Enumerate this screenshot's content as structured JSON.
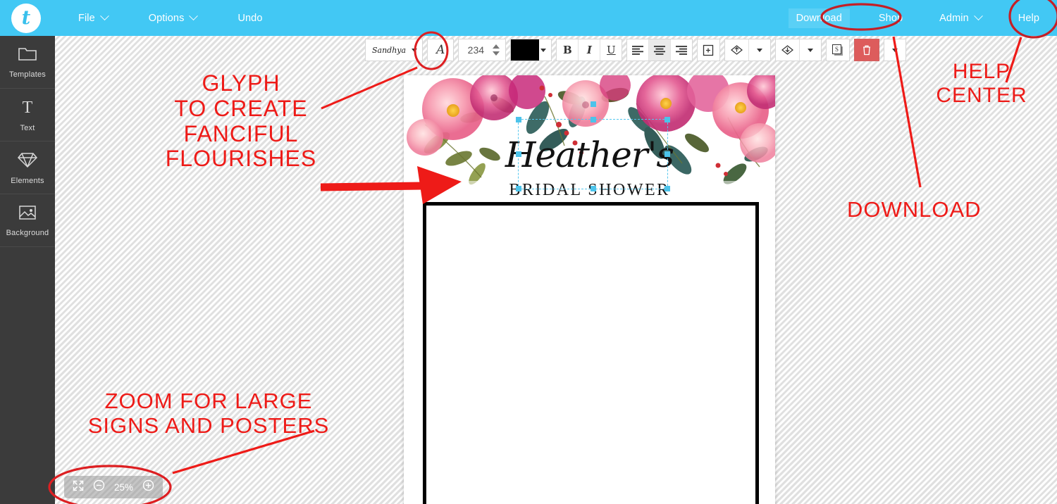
{
  "app": {
    "logo_letter": "t",
    "brand_color": "#42c8f4",
    "annotation_color": "#ee1b18"
  },
  "topnav": {
    "left_items": [
      {
        "label": "File",
        "has_caret": true
      },
      {
        "label": "Options",
        "has_caret": true
      },
      {
        "label": "Undo",
        "has_caret": false
      }
    ],
    "right_items": [
      {
        "label": "Download",
        "has_caret": false,
        "highlighted": true
      },
      {
        "label": "Shop",
        "has_caret": false,
        "highlighted": false
      },
      {
        "label": "Admin",
        "has_caret": true,
        "highlighted": false
      },
      {
        "label": "Help",
        "has_caret": false,
        "highlighted": false
      }
    ]
  },
  "sidebar": {
    "items": [
      {
        "label": "Templates",
        "icon": "templates-icon"
      },
      {
        "label": "Text",
        "icon": "text-icon"
      },
      {
        "label": "Elements",
        "icon": "diamond-icon"
      },
      {
        "label": "Background",
        "icon": "image-icon"
      }
    ]
  },
  "toolbar": {
    "font_name": "Sandhya",
    "glyph_label": "A",
    "font_size": "234",
    "text_color": "#000000",
    "bold_label": "B",
    "italic_label": "I",
    "underline_label": "U",
    "align_left": "align-left",
    "align_center": "align-center",
    "align_right": "align-right",
    "duplicate": "duplicate",
    "bring_forward": "bring-forward",
    "send_backward": "send-backward",
    "shadow_label": "S",
    "delete": "delete",
    "more": "more"
  },
  "canvas": {
    "design_title": "Heather's",
    "design_subtitle": "BRIDAL SHOWER"
  },
  "zoom_control": {
    "fit_label": "fit-screen",
    "minus_label": "zoom-out",
    "percent": "25%",
    "plus_label": "zoom-in"
  },
  "annotations": {
    "glyph": "GLYPH\nTO CREATE\nFANCIFUL\nFLOURISHES",
    "help_center": "HELP\nCENTER",
    "download": "DOWNLOAD",
    "zoom": "ZOOM FOR LARGE\nSIGNS AND POSTERS"
  }
}
